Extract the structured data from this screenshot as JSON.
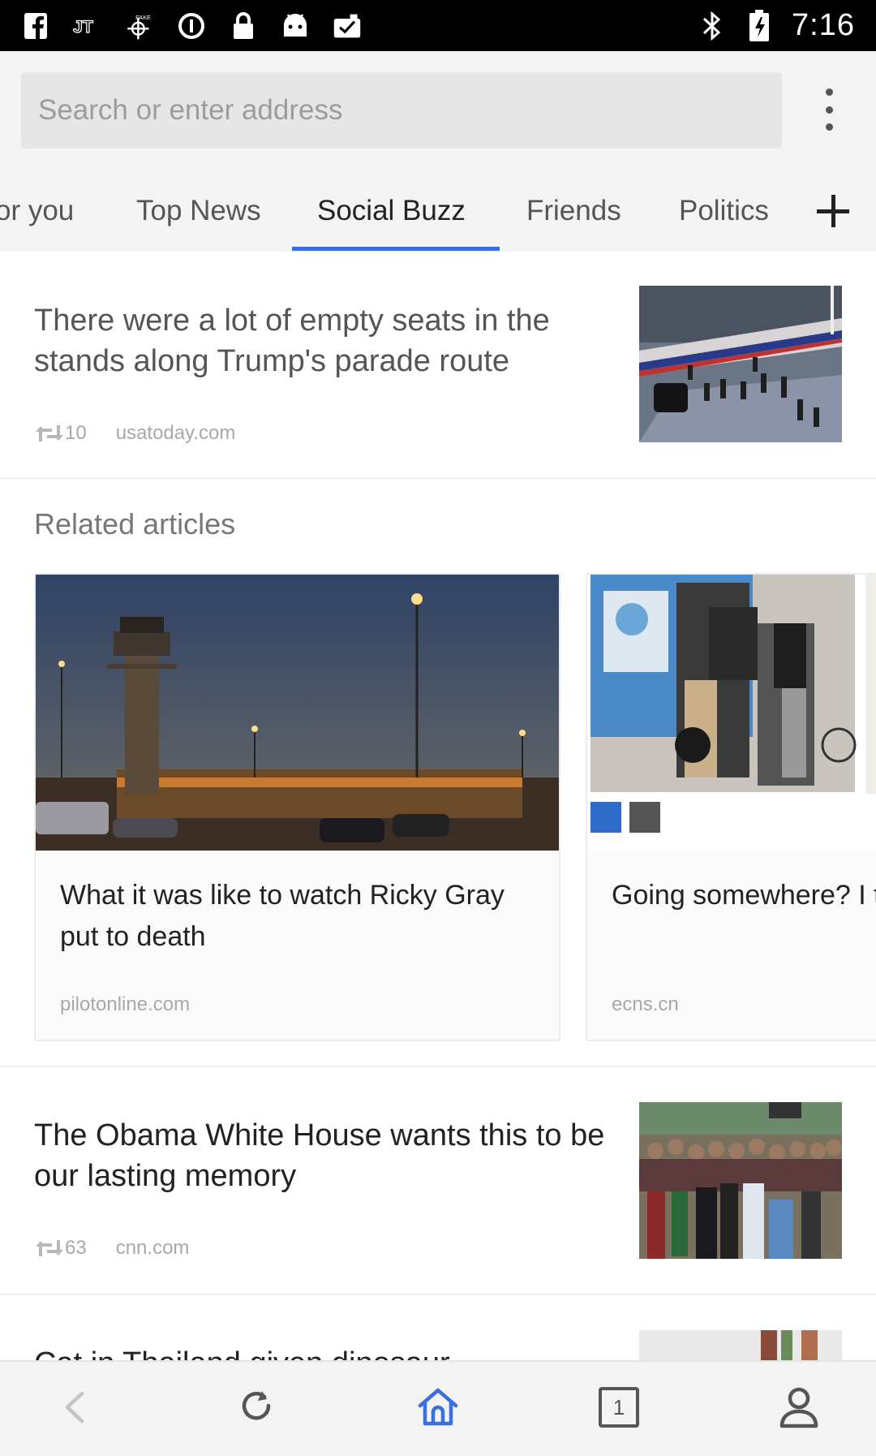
{
  "status_bar": {
    "time": "7:16",
    "icons": [
      "facebook-icon",
      "jt-icon",
      "fake-gps-icon",
      "data-saver-icon",
      "lock-icon",
      "android-icon",
      "clipboard-check-icon",
      "bluetooth-icon",
      "battery-charging-icon"
    ]
  },
  "search": {
    "placeholder": "Search or enter address"
  },
  "tabs": [
    {
      "label": "or you",
      "active": false
    },
    {
      "label": "Top News",
      "active": false
    },
    {
      "label": "Social Buzz",
      "active": true
    },
    {
      "label": "Friends",
      "active": false
    },
    {
      "label": "Politics",
      "active": false
    }
  ],
  "accent_color": "#3b6fe0",
  "feed": {
    "article1": {
      "title": "There were a lot of empty seats in the stands along Trump's parade route",
      "reposts": "10",
      "source": "usatoday.com"
    },
    "related": {
      "heading": "Related articles",
      "cards": [
        {
          "title": "What it was like to watch Ricky Gray put to death",
          "source": "pilotonline.com"
        },
        {
          "title": "Going somewhere? I take these items",
          "source": "ecns.cn"
        }
      ]
    },
    "article2": {
      "title": "The Obama White House wants this to be our lasting memory",
      "reposts": "63",
      "source": "cnn.com"
    },
    "article3": {
      "title": "Cat in Thailand given dinosaur"
    }
  },
  "bottom_nav": {
    "tab_count": "1",
    "icons": [
      "back-icon",
      "refresh-icon",
      "home-icon",
      "tabs-icon",
      "profile-icon"
    ]
  }
}
